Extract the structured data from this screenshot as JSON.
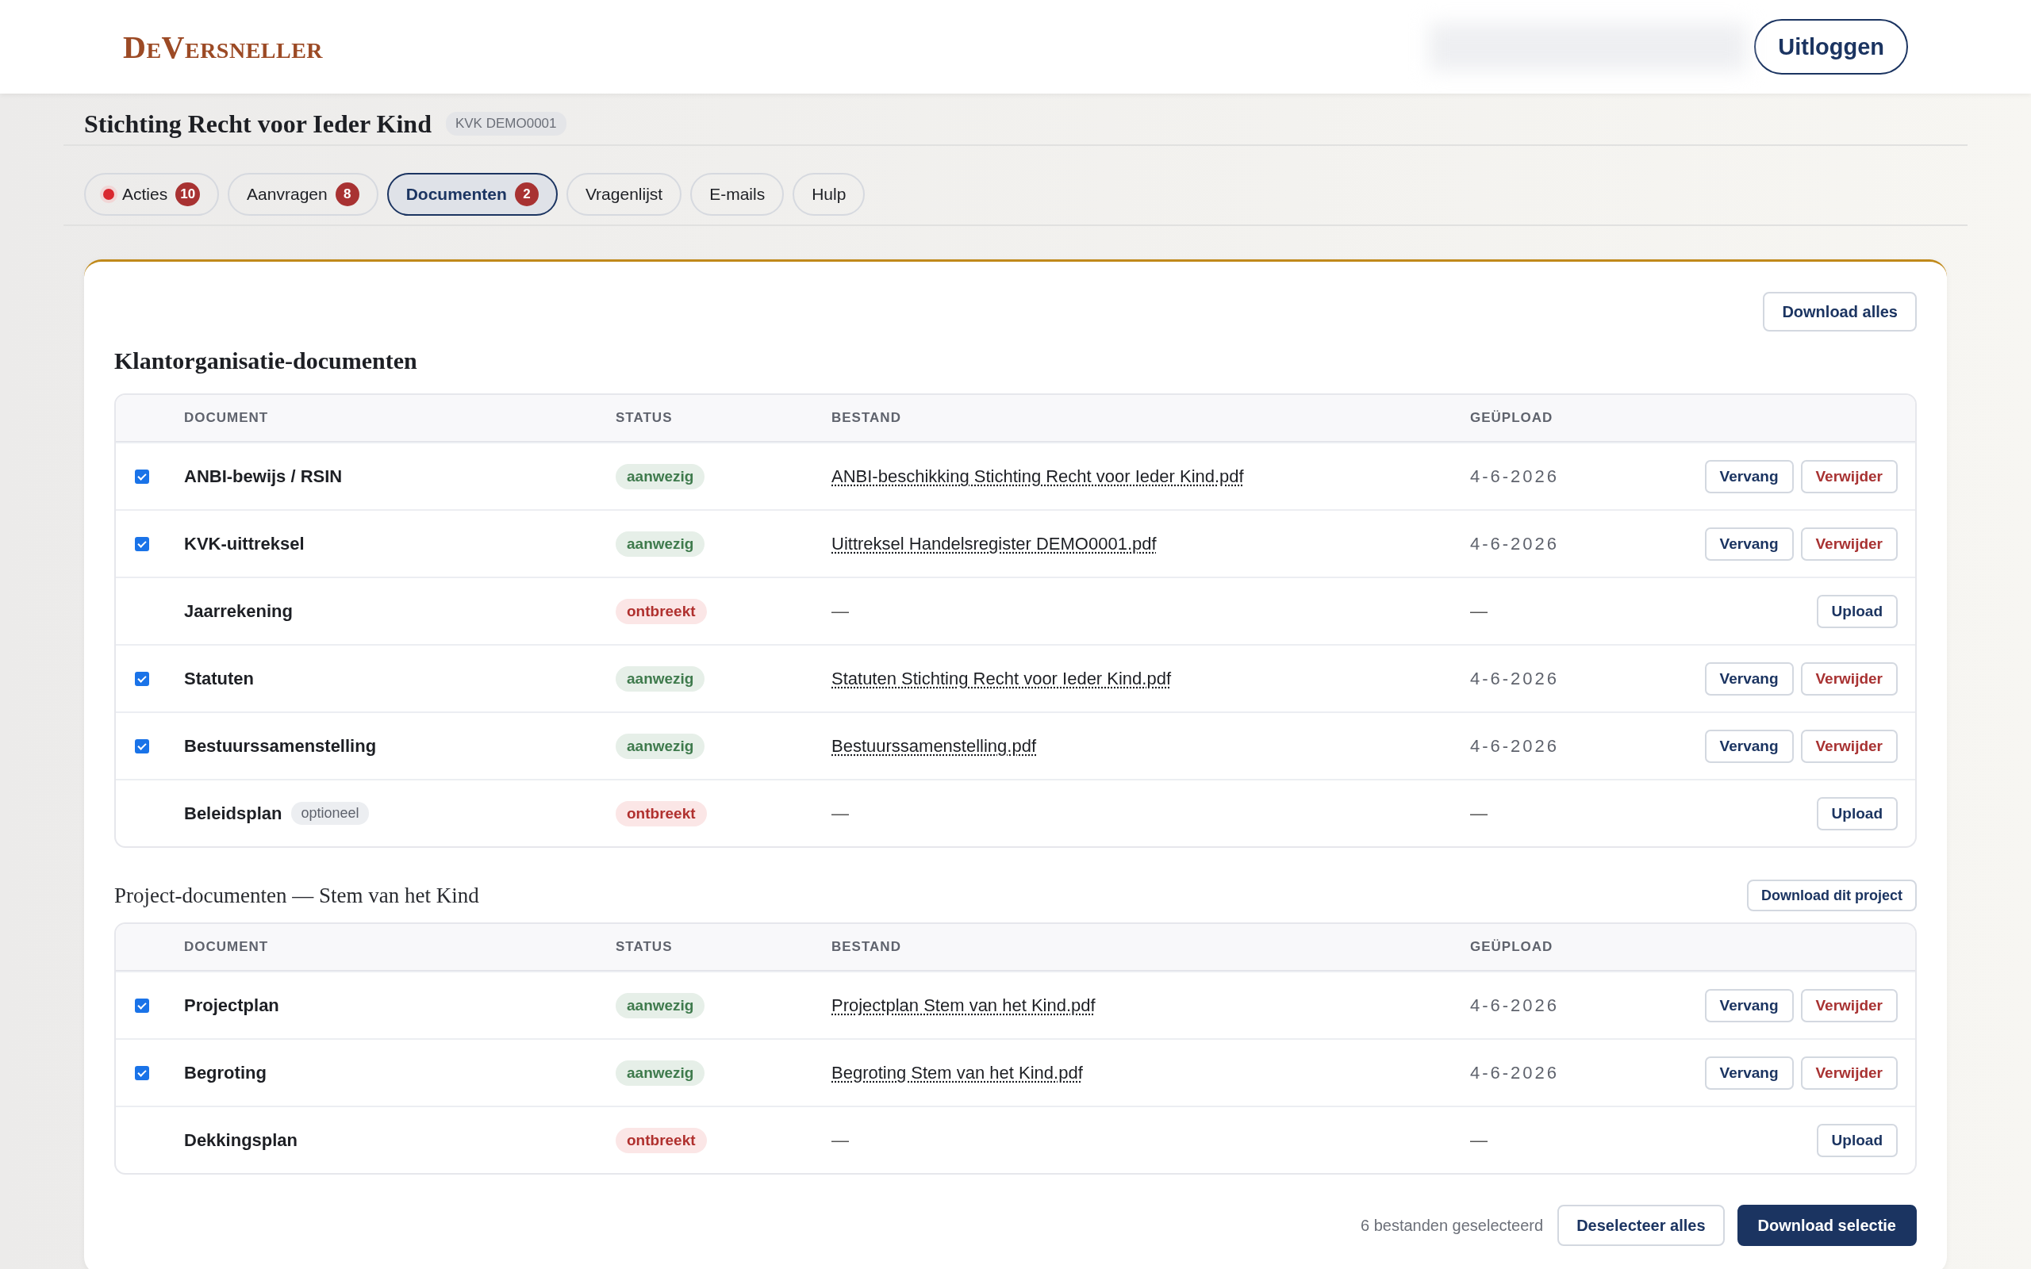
{
  "header": {
    "logo": "DeVersneller",
    "logout_button": "Uitloggen"
  },
  "organization": {
    "name": "Stichting Recht voor Ieder Kind",
    "registration": "KVK DEMO0001"
  },
  "tabs": [
    {
      "label": "Acties",
      "count": "10",
      "alert": true,
      "selected": false
    },
    {
      "label": "Aanvragen",
      "count": "8",
      "alert": false,
      "selected": false
    },
    {
      "label": "Documenten",
      "count": "2",
      "alert": false,
      "selected": true
    },
    {
      "label": "Vragenlijst",
      "alert": false,
      "selected": false
    },
    {
      "label": "E-mails",
      "alert": false,
      "selected": false
    },
    {
      "label": "Hulp",
      "alert": false,
      "selected": false
    }
  ],
  "sections": [
    {
      "kind": "organization",
      "title": "Klantorganisatie-documenten",
      "download_button": "Download alles",
      "columns": [
        "DOCUMENT",
        "STATUS",
        "BESTAND",
        "GEÜPLOAD"
      ],
      "rows": [
        {
          "checked": true,
          "document": "ANBI-bewijs / RSIN",
          "status": {
            "label": "aanwezig",
            "kind": "present"
          },
          "file": "ANBI-beschikking Stichting Recht voor Ieder Kind.pdf",
          "uploaded": "4-6-2026",
          "actions": [
            {
              "label": "Vervang",
              "kind": "replace"
            },
            {
              "label": "Verwijder",
              "kind": "delete"
            }
          ]
        },
        {
          "checked": true,
          "document": "KVK-uittreksel",
          "status": {
            "label": "aanwezig",
            "kind": "present"
          },
          "file": "Uittreksel Handelsregister DEMO0001.pdf",
          "uploaded": "4-6-2026",
          "actions": [
            {
              "label": "Vervang",
              "kind": "replace"
            },
            {
              "label": "Verwijder",
              "kind": "delete"
            }
          ]
        },
        {
          "document": "Jaarrekening",
          "status": {
            "label": "ontbreekt",
            "kind": "missing"
          },
          "file": "—",
          "uploaded": "—",
          "actions": [
            {
              "label": "Upload",
              "kind": "upload"
            }
          ]
        },
        {
          "checked": true,
          "document": "Statuten",
          "status": {
            "label": "aanwezig",
            "kind": "present"
          },
          "file": "Statuten Stichting Recht voor Ieder Kind.pdf",
          "uploaded": "4-6-2026",
          "actions": [
            {
              "label": "Vervang",
              "kind": "replace"
            },
            {
              "label": "Verwijder",
              "kind": "delete"
            }
          ]
        },
        {
          "checked": true,
          "document": "Bestuurssamenstelling",
          "status": {
            "label": "aanwezig",
            "kind": "present"
          },
          "file": "Bestuurssamenstelling.pdf",
          "uploaded": "4-6-2026",
          "actions": [
            {
              "label": "Vervang",
              "kind": "replace"
            },
            {
              "label": "Verwijder",
              "kind": "delete"
            }
          ]
        },
        {
          "document": "Beleidsplan",
          "tag": "optioneel",
          "status": {
            "label": "ontbreekt",
            "kind": "missing"
          },
          "file": "—",
          "uploaded": "—",
          "actions": [
            {
              "label": "Upload",
              "kind": "upload"
            }
          ]
        }
      ]
    },
    {
      "kind": "project",
      "title": "Project-documenten — Stem van het Kind",
      "download_button": "Download dit project",
      "columns": [
        "DOCUMENT",
        "STATUS",
        "BESTAND",
        "GEÜPLOAD"
      ],
      "rows": [
        {
          "checked": true,
          "document": "Projectplan",
          "status": {
            "label": "aanwezig",
            "kind": "present"
          },
          "file": "Projectplan Stem van het Kind.pdf",
          "uploaded": "4-6-2026",
          "actions": [
            {
              "label": "Vervang",
              "kind": "replace"
            },
            {
              "label": "Verwijder",
              "kind": "delete"
            }
          ]
        },
        {
          "checked": true,
          "document": "Begroting",
          "status": {
            "label": "aanwezig",
            "kind": "present"
          },
          "file": "Begroting Stem van het Kind.pdf",
          "uploaded": "4-6-2026",
          "actions": [
            {
              "label": "Vervang",
              "kind": "replace"
            },
            {
              "label": "Verwijder",
              "kind": "delete"
            }
          ]
        },
        {
          "document": "Dekkingsplan",
          "status": {
            "label": "ontbreekt",
            "kind": "missing"
          },
          "file": "—",
          "uploaded": "—",
          "actions": [
            {
              "label": "Upload",
              "kind": "upload"
            }
          ]
        }
      ]
    }
  ],
  "footer": {
    "selection_count": "6 bestanden geselecteerd",
    "deselect_button": "Deselecteer alles",
    "download_button": "Download selectie"
  }
}
